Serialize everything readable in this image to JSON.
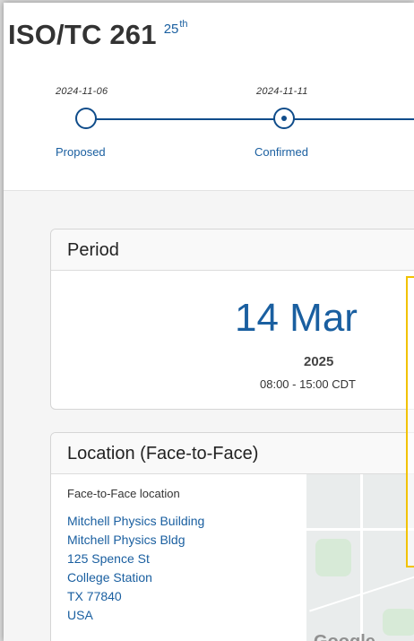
{
  "header": {
    "title": "ISO/TC 261",
    "edition_number": "25",
    "edition_suffix": "th"
  },
  "timeline": [
    {
      "date": "2024-11-06",
      "label": "Proposed",
      "state": "completed"
    },
    {
      "date": "2024-11-11",
      "label": "Confirmed",
      "state": "current"
    }
  ],
  "period": {
    "heading": "Period",
    "day_month": "14 Mar",
    "year": "2025",
    "time": "08:00 - 15:00 CDT"
  },
  "location": {
    "heading": "Location (Face-to-Face)",
    "caption": "Face-to-Face location",
    "address": [
      "Mitchell Physics Building",
      "Mitchell Physics Bldg",
      "125 Spence St",
      "College Station",
      "TX 77840",
      "USA"
    ],
    "map_brand": "Google"
  },
  "colors": {
    "accent": "#1a5fa0",
    "timeline": "#0f4c8a",
    "highlight": "#f2c200"
  }
}
